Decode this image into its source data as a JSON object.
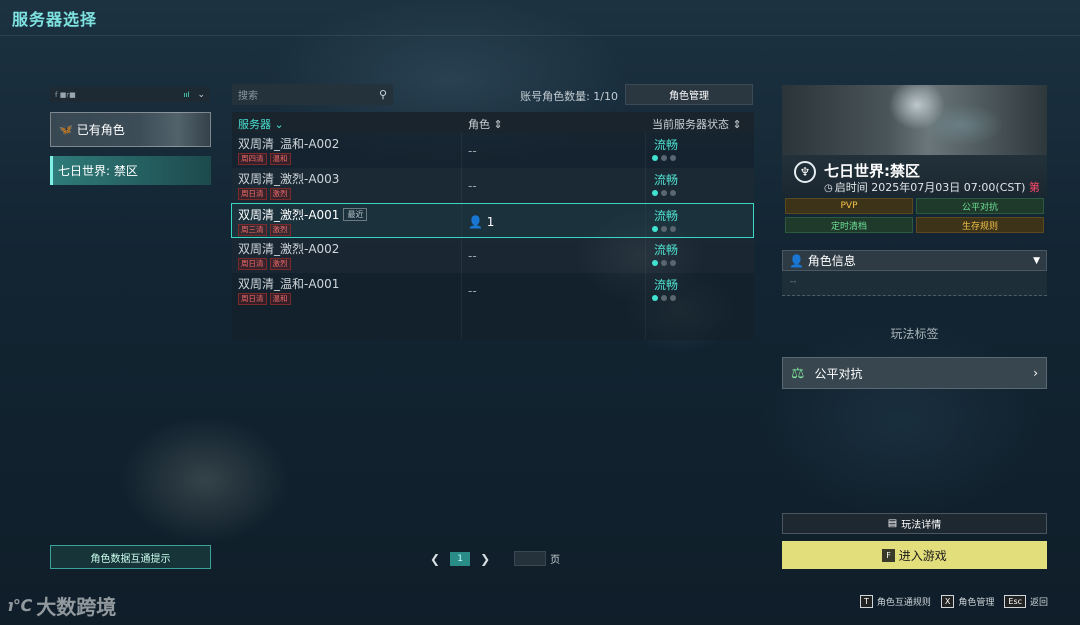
{
  "page_title": "服务器选择",
  "left": {
    "header_text": "f ■r■",
    "signal": "ııl",
    "existing_characters": "已有角色",
    "world_tab": "七日世界: 禁区",
    "hint_button": "角色数据互通提示"
  },
  "center": {
    "search_placeholder": "搜索",
    "account_count": "账号角色数量: 1/10",
    "role_manage": "角色管理",
    "columns": {
      "server": "服务器",
      "role": "角色",
      "status": "当前服务器状态"
    },
    "rows": [
      {
        "name": "双周清_温和-A002",
        "tag1": "周四清",
        "tag2": "温和",
        "role": "--",
        "status": "流畅",
        "recent": ""
      },
      {
        "name": "双周清_激烈-A003",
        "tag1": "周日清",
        "tag2": "激烈",
        "role": "--",
        "status": "流畅",
        "recent": ""
      },
      {
        "name": "双周清_激烈-A001",
        "tag1": "周三清",
        "tag2": "激烈",
        "role": "1",
        "status": "流畅",
        "recent": "最近"
      },
      {
        "name": "双周清_激烈-A002",
        "tag1": "周日清",
        "tag2": "激烈",
        "role": "--",
        "status": "流畅",
        "recent": ""
      },
      {
        "name": "双周清_温和-A001",
        "tag1": "周日清",
        "tag2": "温和",
        "role": "--",
        "status": "流畅",
        "recent": ""
      }
    ],
    "pager": {
      "current": "1",
      "page_label": "页"
    }
  },
  "right": {
    "world_name": "七日世界:禁区",
    "open_time_label": "启时间 2025年07月03日 07:00(CST)",
    "open_time_suffix": "第",
    "modes": {
      "pvp": "PVP",
      "fair": "公平对抗",
      "clear": "定时清档",
      "survival": "生存规则"
    },
    "role_info": "角色信息",
    "role_info_sub": "--",
    "play_tag_title": "玩法标签",
    "play_tag": "公平对抗",
    "detail_button": "玩法详情",
    "enter_key": "F",
    "enter_button": "进入游戏"
  },
  "hints": [
    {
      "key": "T",
      "label": "角色互通规则"
    },
    {
      "key": "X",
      "label": "角色管理"
    },
    {
      "key": "Esc",
      "label": "返回"
    }
  ],
  "watermark": "大数跨境"
}
